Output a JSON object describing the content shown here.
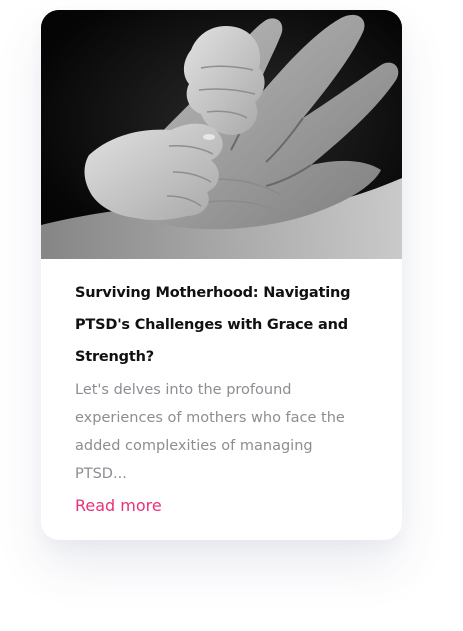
{
  "card": {
    "image_alt": "Black and white photo of a baby's hands resting in an adult's open palm",
    "title_lines": [
      "Surviving Motherhood: Navigating",
      "PTSD's Challenges with Grace and",
      "Strength?"
    ],
    "excerpt_lines": [
      "Let's delves into the profound",
      "experiences of mothers who face the",
      "added complexities of managing",
      "PTSD..."
    ],
    "read_more_label": "Read more"
  },
  "colors": {
    "accent": "#e8317b",
    "title": "#111111",
    "excerpt": "#8d8d93",
    "image_background": "#0b0b0b"
  }
}
